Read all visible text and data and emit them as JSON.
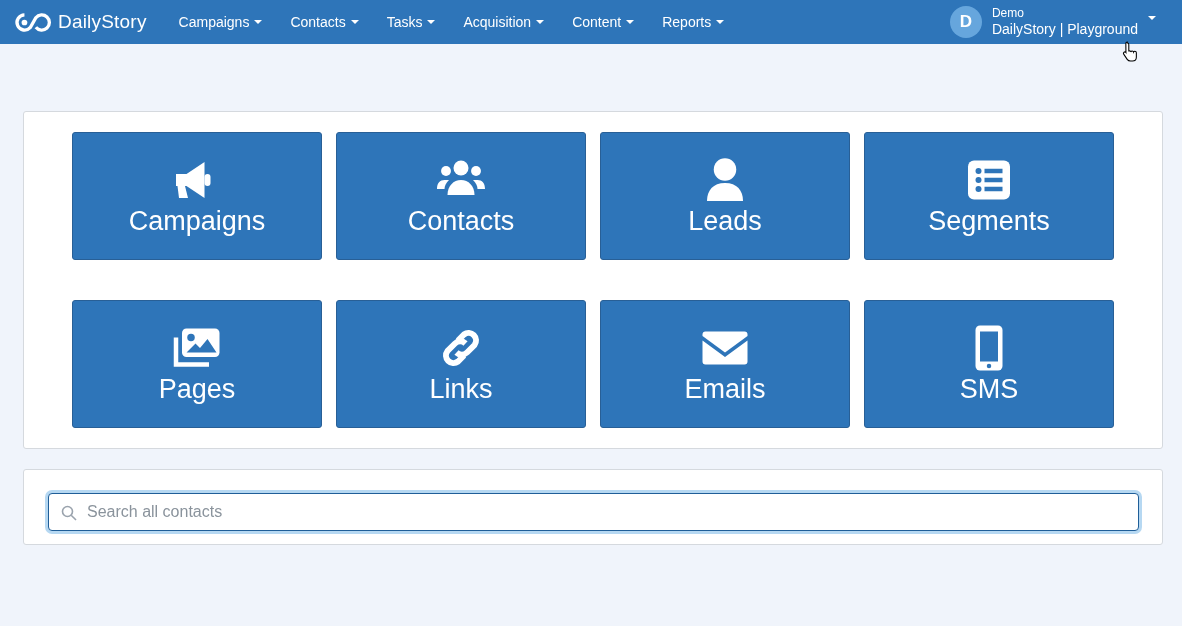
{
  "navbar": {
    "brand": "DailyStory",
    "menus": [
      {
        "label": "Campaigns"
      },
      {
        "label": "Contacts"
      },
      {
        "label": "Tasks"
      },
      {
        "label": "Acquisition"
      },
      {
        "label": "Content"
      },
      {
        "label": "Reports"
      }
    ],
    "account": {
      "initial": "D",
      "user": "Demo",
      "workspace": "DailyStory | Playground"
    }
  },
  "tiles": [
    {
      "kind": "megaphone",
      "label": "Campaigns"
    },
    {
      "kind": "people",
      "label": "Contacts"
    },
    {
      "kind": "person",
      "label": "Leads"
    },
    {
      "kind": "list",
      "label": "Segments"
    },
    {
      "kind": "images",
      "label": "Pages"
    },
    {
      "kind": "link",
      "label": "Links"
    },
    {
      "kind": "envelope",
      "label": "Emails"
    },
    {
      "kind": "phone",
      "label": "SMS"
    }
  ],
  "search": {
    "placeholder": "Search all contacts"
  }
}
